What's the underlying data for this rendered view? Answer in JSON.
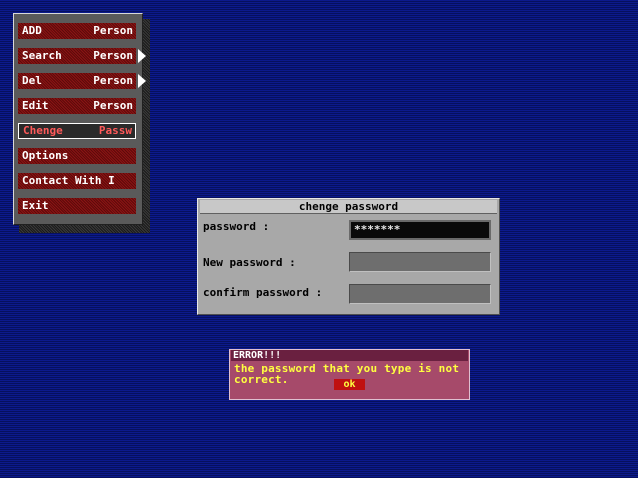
{
  "menu": {
    "items": [
      {
        "label": "ADD",
        "label2": "Person"
      },
      {
        "label": "Search",
        "label2": "Person"
      },
      {
        "label": "Del",
        "label2": "Person"
      },
      {
        "label": "Edit",
        "label2": "Person"
      },
      {
        "label": "Chenge",
        "label2": "Passw"
      },
      {
        "label": "Options",
        "label2": ""
      },
      {
        "label": "Contact With I",
        "label2": ""
      },
      {
        "label": "Exit",
        "label2": ""
      }
    ],
    "selected_index": 4
  },
  "change_password": {
    "title": "chenge password",
    "password_label": "password :",
    "password_value": "*******",
    "new_password_label": "New password :",
    "new_password_value": "",
    "confirm_password_label": "confirm password :",
    "confirm_password_value": ""
  },
  "error": {
    "title": "ERROR!!!",
    "message": "the password that you type is not correct.",
    "ok_label": "ok"
  },
  "colors": {
    "background": "#0a147a",
    "menu_item": "#7a1010",
    "selected_text": "#ff5a5a",
    "dialog": "#a8a8a8",
    "error_box": "#a64a6a",
    "error_text": "#ffff40"
  }
}
